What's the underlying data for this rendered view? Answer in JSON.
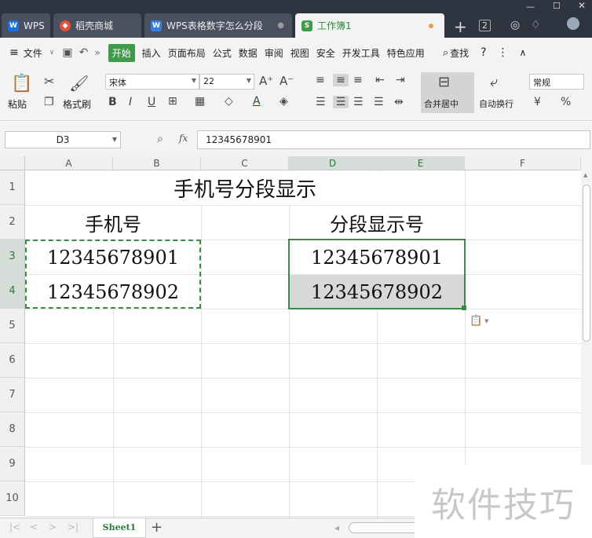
{
  "tabs": [
    {
      "label": "WPS"
    },
    {
      "label": "稻壳商城"
    },
    {
      "label": "WPS表格数字怎么分段"
    },
    {
      "label": "工作簿1"
    }
  ],
  "tab_new": "+",
  "tab_count": "2",
  "menu": [
    "文件",
    "开始",
    "插入",
    "页面布局",
    "公式",
    "数据",
    "审阅",
    "视图",
    "安全",
    "开发工具",
    "特色应用"
  ],
  "menu_search": "查找",
  "ribbon": {
    "paste": "粘贴",
    "format_painter": "格式刷",
    "font_name": "宋体",
    "font_size": "22",
    "merge_center": "合并居中",
    "wrap_text": "自动换行",
    "number_format": "常规"
  },
  "formula": {
    "cell_ref": "D3",
    "fx": "fx",
    "value": "12345678901"
  },
  "columns": [
    "A",
    "B",
    "C",
    "D",
    "E",
    "F"
  ],
  "rows": [
    "1",
    "2",
    "3",
    "4",
    "5",
    "6",
    "7",
    "8",
    "9",
    "10"
  ],
  "cells": {
    "title": "手机号分段显示",
    "header_phone": "手机号",
    "header_segment": "分段显示号",
    "a3": "12345678901",
    "a4": "12345678902",
    "d3": "12345678901",
    "d4": "12345678902"
  },
  "sheet": {
    "name": "Sheet1",
    "add": "+"
  },
  "watermark": "软件技巧",
  "colors": {
    "accent": "#3f9a4c",
    "selection": "#3a8a46",
    "tabbar": "#2e3440"
  }
}
